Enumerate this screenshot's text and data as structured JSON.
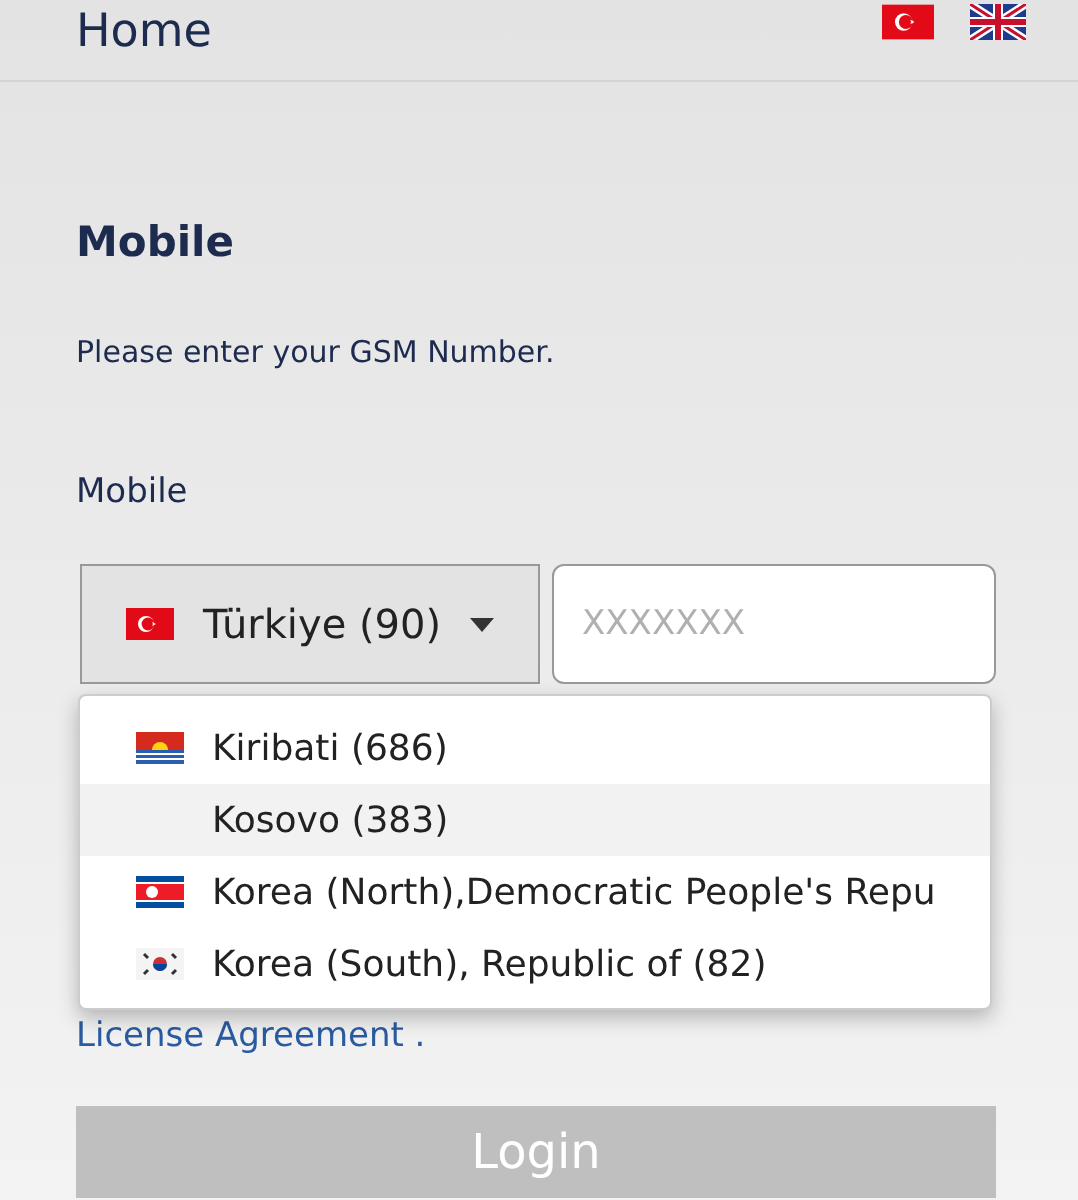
{
  "header": {
    "title": "Home"
  },
  "section_title": "Mobile",
  "description": "Please enter your GSM Number.",
  "field_label": "Mobile",
  "country_select": {
    "value": "Türkiye (90)",
    "expanded": true
  },
  "phone_field": {
    "placeholder": "XXXXXXX"
  },
  "country_options": [
    {
      "label": "Kiribati (686)",
      "highlighted": false
    },
    {
      "label": "Kosovo (383)",
      "highlighted": true
    },
    {
      "label": "Korea (North),Democratic People's Repu",
      "highlighted": false
    },
    {
      "label": "Korea (South), Republic of (82)",
      "highlighted": false
    }
  ],
  "agreement_link": "License Agreement .",
  "login_button": "Login"
}
